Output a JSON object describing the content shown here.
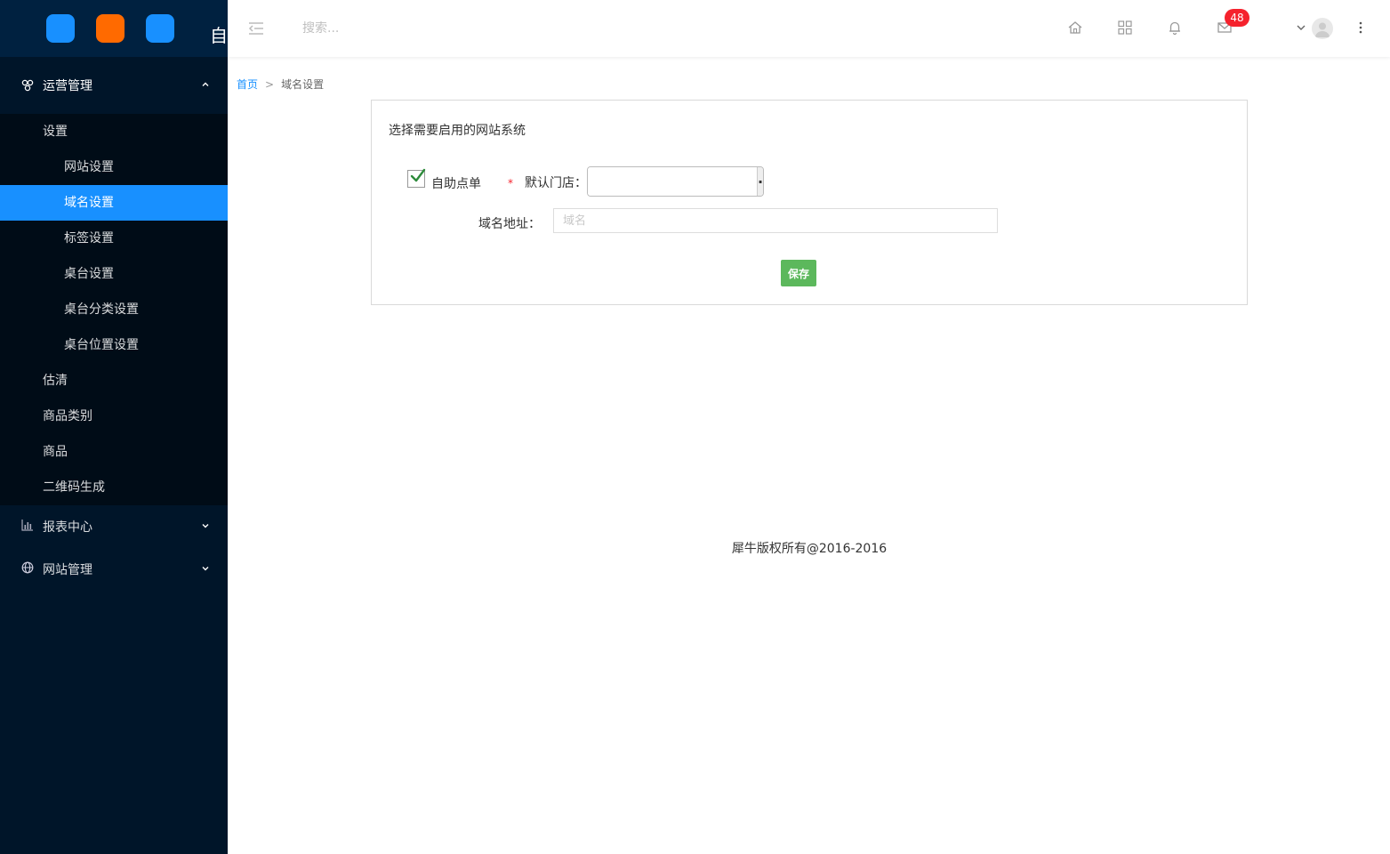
{
  "colors": {
    "sidebar_bg": "#001529",
    "accent": "#1890ff",
    "save_green": "#5cb85c",
    "badge_red": "#f5222d"
  },
  "logo": {
    "text": "自",
    "squares": [
      "#1890ff",
      "#ff6a00",
      "#1890ff"
    ]
  },
  "sidebar": {
    "groups": [
      {
        "label": "运营管理",
        "icon": "cluster-icon",
        "expanded": true,
        "items": [
          {
            "label": "设置",
            "children": [
              {
                "label": "网站设置"
              },
              {
                "label": "域名设置",
                "active": true
              },
              {
                "label": "标签设置"
              },
              {
                "label": "桌台设置"
              },
              {
                "label": "桌台分类设置"
              },
              {
                "label": "桌台位置设置"
              }
            ]
          },
          {
            "label": "估清"
          },
          {
            "label": "商品类别"
          },
          {
            "label": "商品"
          },
          {
            "label": "二维码生成"
          }
        ]
      },
      {
        "label": "报表中心",
        "icon": "bar-chart-icon",
        "expanded": false
      },
      {
        "label": "网站管理",
        "icon": "globe-icon",
        "expanded": false
      }
    ]
  },
  "header": {
    "search_placeholder": "搜索...",
    "icons": [
      "home-icon",
      "apps-grid-icon",
      "bell-icon",
      "mail-icon"
    ],
    "mail_badge": "48"
  },
  "breadcrumb": {
    "home": "首页",
    "separator": ">",
    "current": "域名设置"
  },
  "form": {
    "title": "选择需要启用的网站系统",
    "checkbox_label": "自助点单",
    "checkbox_checked": true,
    "required_mark": "*",
    "store_label": "默认门店：",
    "store_value": "",
    "store_button": "···",
    "domain_label": "域名地址：",
    "domain_placeholder": "域名",
    "domain_value": "",
    "save_label": "保存"
  },
  "footer": {
    "text": "犀牛版权所有@2016-2016"
  }
}
